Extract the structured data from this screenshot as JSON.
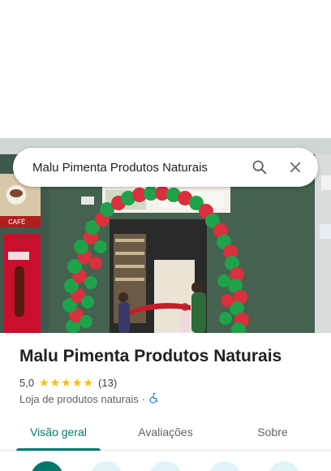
{
  "search": {
    "query": "Malu Pimenta Produtos Naturais",
    "search_icon": "search-icon",
    "close_icon": "close-icon"
  },
  "photo": {
    "description_icon": "storefront-photo"
  },
  "place": {
    "name": "Malu Pimenta Produtos Naturais",
    "rating": "5,0",
    "stars": 5,
    "review_count": "(13)",
    "category": "Loja de produtos naturais",
    "separator": "·",
    "accessibility_icon": "wheelchair-icon"
  },
  "tabs": [
    {
      "label": "Visão geral",
      "active": true
    },
    {
      "label": "Avaliações",
      "active": false
    },
    {
      "label": "Sobre",
      "active": false
    }
  ],
  "colors": {
    "accent": "#00796b",
    "star": "#fbbc04",
    "accessibility": "#1a73e8"
  }
}
